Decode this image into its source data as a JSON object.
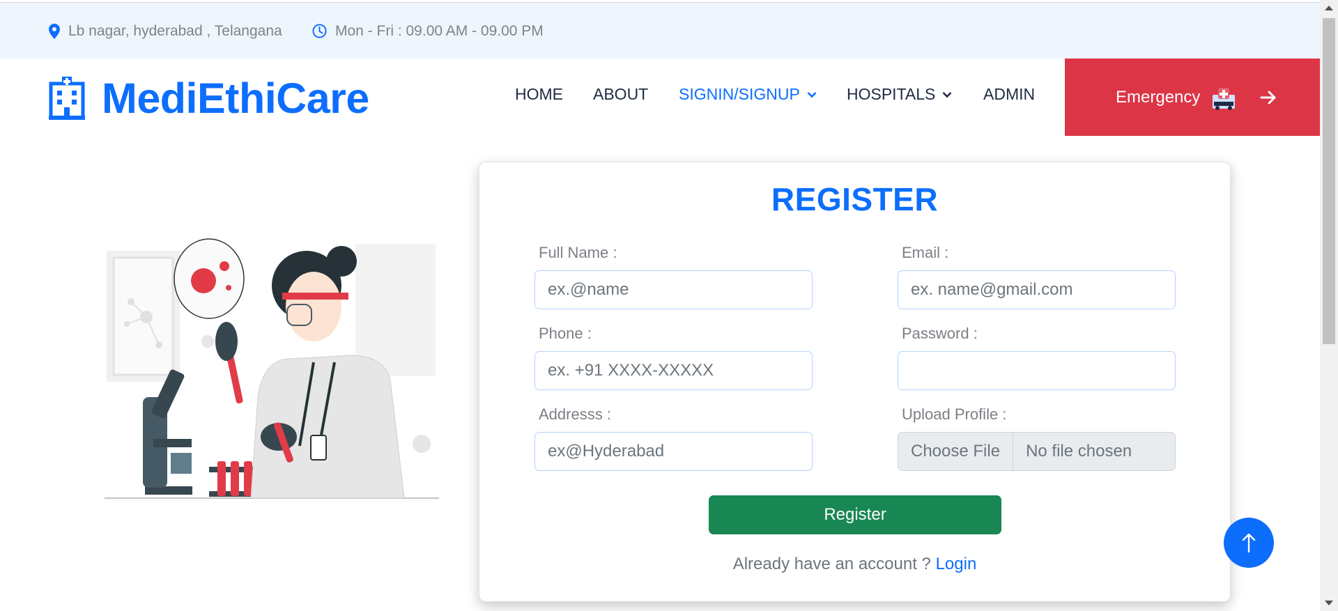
{
  "topbar": {
    "address": "Lb nagar, hyderabad , Telangana",
    "hours": "Mon - Fri : 09.00 AM - 09.00 PM"
  },
  "brand": {
    "name": "MediEthiCare",
    "icon": "hospital-building-icon"
  },
  "nav": {
    "items": [
      {
        "label": "HOME",
        "active": false,
        "dropdown": false
      },
      {
        "label": "ABOUT",
        "active": false,
        "dropdown": false
      },
      {
        "label": "SIGNIN/SIGNUP",
        "active": true,
        "dropdown": true
      },
      {
        "label": "HOSPITALS",
        "active": false,
        "dropdown": true
      },
      {
        "label": "ADMIN",
        "active": false,
        "dropdown": false
      }
    ],
    "emergency_label": "Emergency"
  },
  "form": {
    "title": "REGISTER",
    "full_name": {
      "label": "Full Name :",
      "placeholder": "ex.@name",
      "value": ""
    },
    "email": {
      "label": "Email :",
      "placeholder": "ex. name@gmail.com",
      "value": ""
    },
    "phone": {
      "label": "Phone :",
      "placeholder": "ex. +91 XXXX-XXXXX",
      "value": ""
    },
    "password": {
      "label": "Password :",
      "placeholder": "",
      "value": ""
    },
    "address": {
      "label": "Addresss :",
      "placeholder": "ex@Hyderabad",
      "value": ""
    },
    "upload": {
      "label": "Upload Profile :",
      "button": "Choose File",
      "status": "No file chosen"
    },
    "submit_label": "Register",
    "login_prompt": "Already have an account ? ",
    "login_link": "Login"
  },
  "colors": {
    "primary": "#0d6efd",
    "emergency": "#dc3545",
    "success": "#198754",
    "topbar_bg": "#eef5fc"
  }
}
